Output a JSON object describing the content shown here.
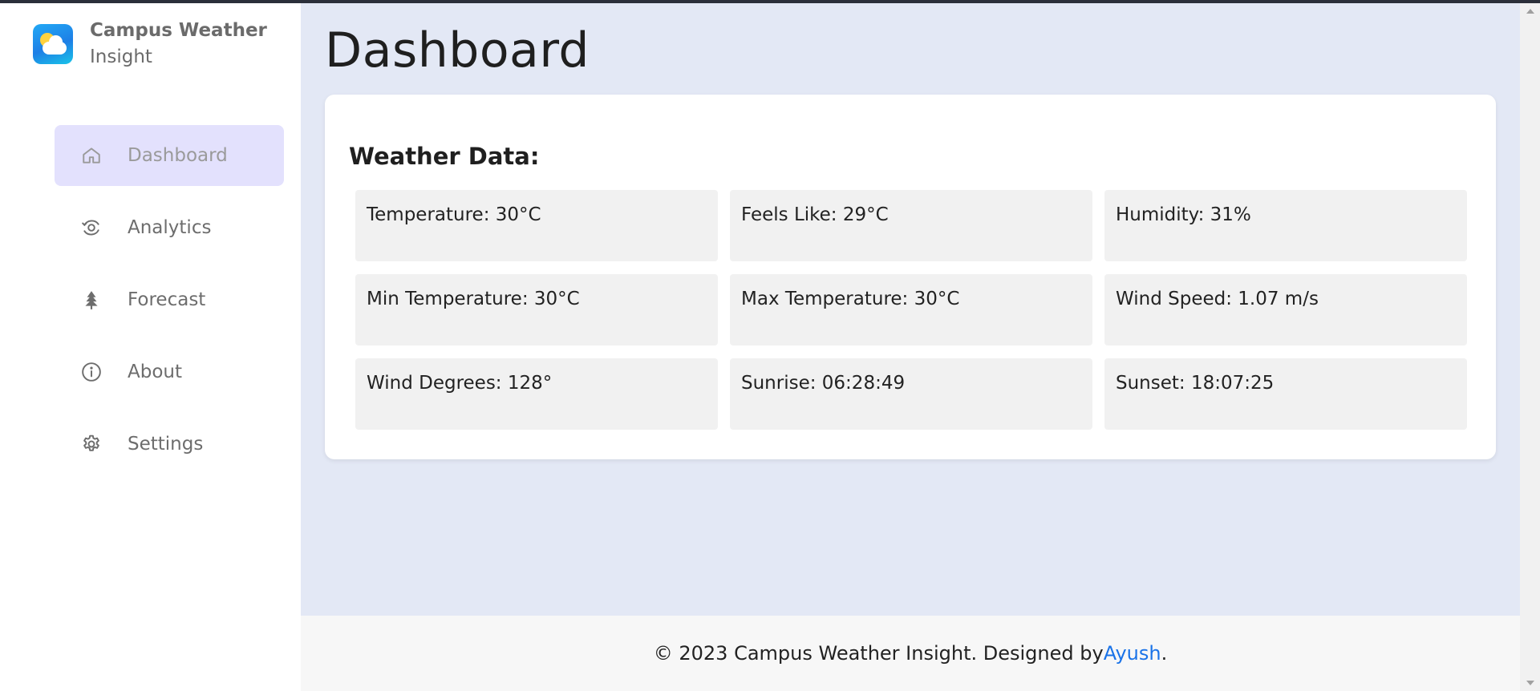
{
  "brand": {
    "name_line1": "Campus Weather",
    "name_line2": "Insight",
    "logo_icon": "weather-cloud-sun-icon"
  },
  "nav": {
    "items": [
      {
        "label": "Dashboard",
        "icon": "home-icon",
        "active": true
      },
      {
        "label": "Analytics",
        "icon": "analytics-icon",
        "active": false
      },
      {
        "label": "Forecast",
        "icon": "tree-icon",
        "active": false
      },
      {
        "label": "About",
        "icon": "info-icon",
        "active": false
      },
      {
        "label": "Settings",
        "icon": "gear-icon",
        "active": false
      }
    ]
  },
  "main": {
    "title": "Dashboard",
    "card_title": "Weather Data:",
    "weather": [
      "Temperature: 30°C",
      "Feels Like: 29°C",
      "Humidity: 31%",
      "Min Temperature: 30°C",
      "Max Temperature: 30°C",
      "Wind Speed: 1.07 m/s",
      "Wind Degrees: 128°",
      "Sunrise: 06:28:49",
      "Sunset: 18:07:25"
    ]
  },
  "footer": {
    "text_before": "© 2023 Campus Weather Insight. Designed by ",
    "author_link": "Ayush",
    "text_after": "."
  },
  "colors": {
    "background": "#e3e8f5",
    "active_nav": "#e3e1fd",
    "link": "#1a73e8"
  }
}
